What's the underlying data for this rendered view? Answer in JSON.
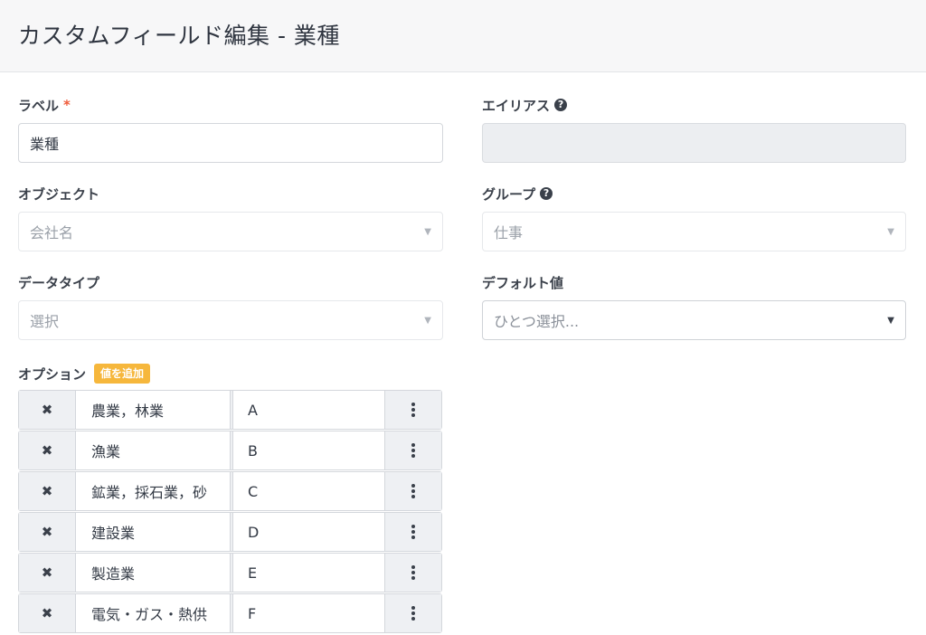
{
  "page_title": "カスタムフィールド編集 - 業種",
  "form": {
    "label": {
      "title": "ラベル",
      "required_mark": "*",
      "value": "業種"
    },
    "alias": {
      "title": "エイリアス",
      "value": ""
    },
    "object": {
      "title": "オブジェクト",
      "value": "会社名"
    },
    "group": {
      "title": "グループ",
      "value": "仕事"
    },
    "data_type": {
      "title": "データタイプ",
      "value": "選択"
    },
    "default_value": {
      "title": "デフォルト値",
      "placeholder": "ひとつ選択..."
    },
    "options": {
      "title": "オプション",
      "add_label": "値を追加",
      "rows": [
        {
          "name": "農業，林業",
          "code": "A"
        },
        {
          "name": "漁業",
          "code": "B"
        },
        {
          "name": "鉱業，採石業，砂",
          "code": "C"
        },
        {
          "name": "建設業",
          "code": "D"
        },
        {
          "name": "製造業",
          "code": "E"
        },
        {
          "name": "電気・ガス・熱供",
          "code": "F"
        }
      ]
    }
  },
  "icons": {
    "help": "?",
    "caret": "▼",
    "delete": "✖"
  },
  "colors": {
    "required": "#ef5b3a",
    "add_badge": "#f6b73c",
    "header_bg": "#f7f7f8"
  }
}
